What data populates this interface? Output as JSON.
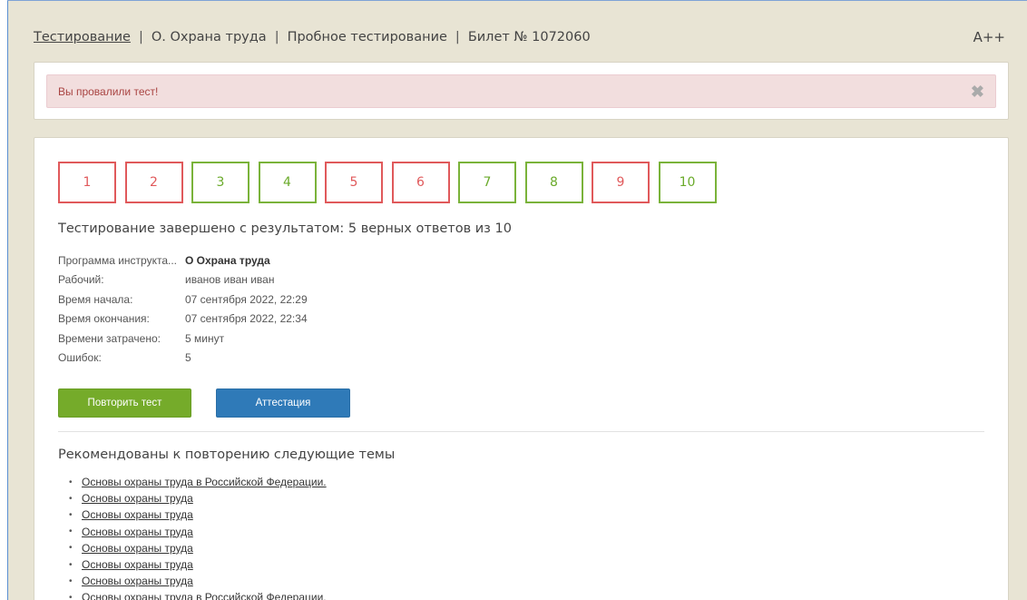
{
  "header": {
    "crumbs": [
      "Тестирование",
      "О. Охрана труда",
      "Пробное тестирование",
      "Билет № 1072060"
    ],
    "separator": "|",
    "font_size_toggle": "A++"
  },
  "alert": {
    "message": "Вы провалили тест!",
    "close": "✖"
  },
  "questions": [
    {
      "num": "1",
      "status": "wrong"
    },
    {
      "num": "2",
      "status": "wrong"
    },
    {
      "num": "3",
      "status": "right"
    },
    {
      "num": "4",
      "status": "right"
    },
    {
      "num": "5",
      "status": "wrong"
    },
    {
      "num": "6",
      "status": "wrong"
    },
    {
      "num": "7",
      "status": "right"
    },
    {
      "num": "8",
      "status": "right"
    },
    {
      "num": "9",
      "status": "wrong"
    },
    {
      "num": "10",
      "status": "right"
    }
  ],
  "result_title": "Тестирование завершено с результатом: 5 верных ответов из 10",
  "info": [
    {
      "key": "Программа инструкта...",
      "value": "О Охрана труда",
      "bold": true
    },
    {
      "key": "Рабочий:",
      "value": "иванов иван иван"
    },
    {
      "key": "Время начала:",
      "value": "07 сентября 2022, 22:29"
    },
    {
      "key": "Время окончания:",
      "value": "07 сентября 2022, 22:34"
    },
    {
      "key": "Времени затрачено:",
      "value": "5 минут"
    },
    {
      "key": "Ошибок:",
      "value": "5"
    }
  ],
  "buttons": {
    "retry": "Повторить тест",
    "attest": "Аттестация"
  },
  "recommend_title": "Рекомендованы к повторению следующие темы",
  "topics": [
    "Основы охраны труда в Российской Федерации.",
    "Основы охраны труда",
    "Основы охраны труда",
    "Основы охраны труда",
    "Основы охраны труда",
    "Основы охраны труда",
    "Основы охраны труда",
    "Основы охраны труда в Российской Федерации."
  ],
  "colors": {
    "wrong": "#e0595b",
    "right": "#7ab33a",
    "retry_btn": "#75ab2a",
    "attest_btn": "#2f7ab8",
    "alert_bg": "#f2dede"
  }
}
